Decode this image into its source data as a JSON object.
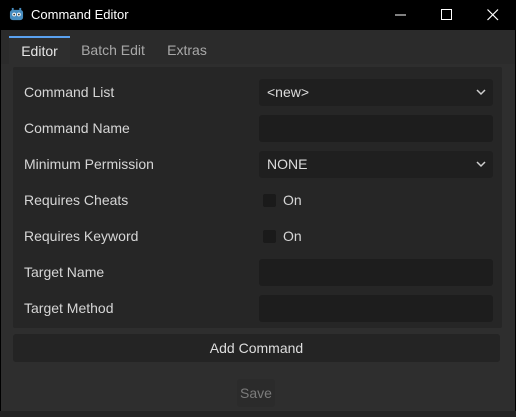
{
  "window": {
    "title": "Command Editor",
    "icons": {
      "app": "godot-icon",
      "minimize": "minimize-icon",
      "maximize": "maximize-icon",
      "close": "close-icon"
    }
  },
  "tabs": [
    {
      "label": "Editor",
      "active": true
    },
    {
      "label": "Batch Edit",
      "active": false
    },
    {
      "label": "Extras",
      "active": false
    }
  ],
  "form": {
    "command_list": {
      "label": "Command List",
      "value": "<new>"
    },
    "command_name": {
      "label": "Command Name",
      "value": ""
    },
    "minimum_permission": {
      "label": "Minimum Permission",
      "value": "NONE"
    },
    "requires_cheats": {
      "label": "Requires Cheats",
      "checkbox_label": "On",
      "checked": false
    },
    "requires_keyword": {
      "label": "Requires Keyword",
      "checkbox_label": "On",
      "checked": false
    },
    "target_name": {
      "label": "Target Name",
      "value": ""
    },
    "target_method": {
      "label": "Target Method",
      "value": ""
    }
  },
  "buttons": {
    "add_command": "Add Command",
    "save": "Save"
  },
  "colors": {
    "accent": "#5aa1f0",
    "panel": "#262626",
    "background": "#2e2e2e"
  }
}
